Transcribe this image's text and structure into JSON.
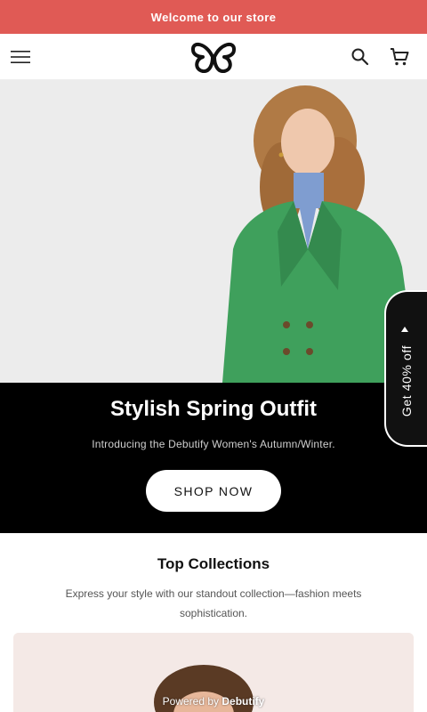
{
  "announcement": {
    "text": "Welcome to our store"
  },
  "header": {
    "menu_icon": "hamburger-menu-icon",
    "logo_icon": "butterfly-logo",
    "search_icon": "search-icon",
    "cart_icon": "cart-icon"
  },
  "hero": {
    "title": "Stylish Spring Outfit",
    "subtitle": "Introducing the Debutify Women's Autumn/Winter.",
    "button_label": "SHOP NOW"
  },
  "promo": {
    "label": "Get 40% off"
  },
  "collections": {
    "title": "Top Collections",
    "description": "Express your style with our standout collection—fashion meets sophistication."
  },
  "footer": {
    "powered_prefix": "Powered by",
    "powered_brand": "Debutify"
  },
  "colors": {
    "announcement_bg": "#e05a55",
    "hero_bg": "#000000",
    "card_bg": "#f4e9e6"
  }
}
